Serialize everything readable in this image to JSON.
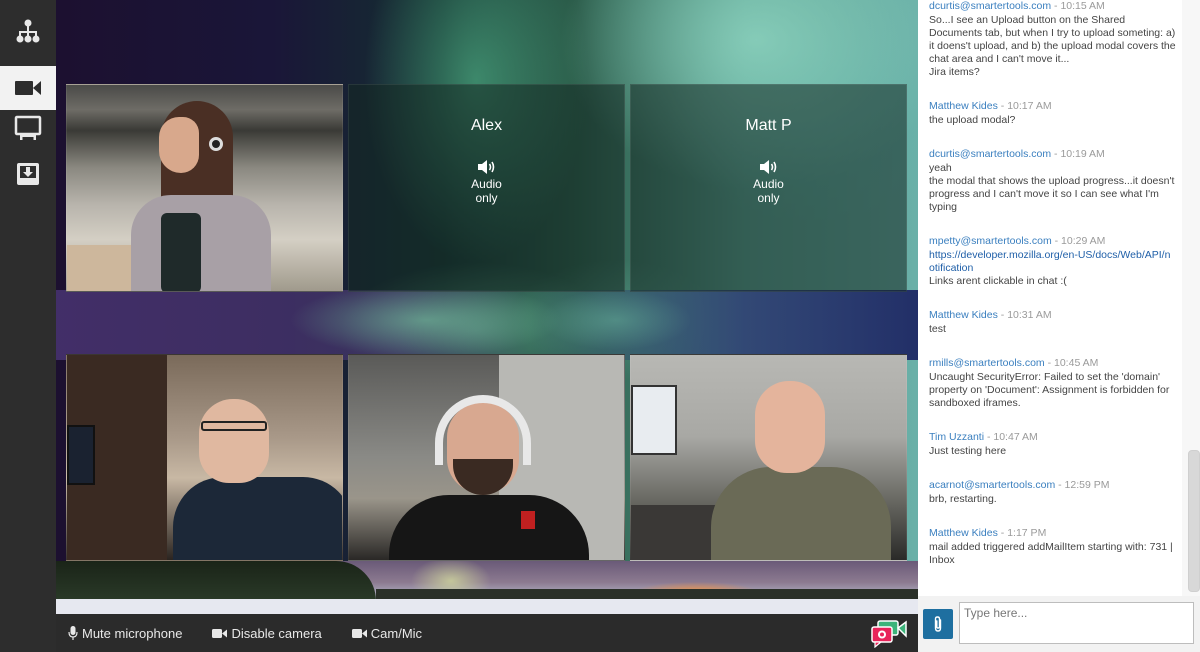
{
  "nav": {
    "items": [
      {
        "name": "org-chart-icon",
        "label": "Participants",
        "active": false
      },
      {
        "name": "video-camera-icon",
        "label": "Video",
        "active": true
      },
      {
        "name": "monitor-icon",
        "label": "Screen share",
        "active": false
      },
      {
        "name": "download-tray-icon",
        "label": "Shared documents",
        "active": false
      }
    ]
  },
  "participants": [
    {
      "id": "p1",
      "type": "video",
      "name": ""
    },
    {
      "id": "p2",
      "type": "audio",
      "name": "Alex",
      "status": "Audio only"
    },
    {
      "id": "p3",
      "type": "audio",
      "name": "Matt P",
      "status": "Audio only"
    },
    {
      "id": "p4",
      "type": "video",
      "name": ""
    },
    {
      "id": "p5",
      "type": "video",
      "name": ""
    },
    {
      "id": "p6",
      "type": "video",
      "name": ""
    }
  ],
  "audio_tiles": {
    "alex": {
      "name": "Alex",
      "status_line1": "Audio",
      "status_line2": "only"
    },
    "mattp": {
      "name": "Matt P",
      "status_line1": "Audio",
      "status_line2": "only"
    }
  },
  "toolbar": {
    "mute_label": "Mute microphone",
    "camera_label": "Disable camera",
    "cammic_label": "Cam/Mic"
  },
  "chat": {
    "messages": [
      {
        "author": "dcurtis@smartertools.com",
        "time": " - 10:15 AM",
        "lines": [
          "So...I see an Upload button on the Shared Documents tab, but when I try to upload someting: a) it doens't upload, and b) the upload modal covers the chat area and I can't move it...",
          "Jira items?"
        ]
      },
      {
        "author": "Matthew Kides",
        "time": " - 10:17 AM",
        "lines": [
          "the upload modal?"
        ]
      },
      {
        "author": "dcurtis@smartertools.com",
        "time": " - 10:19 AM",
        "lines": [
          "yeah",
          "the modal that shows the upload progress...it doesn't progress and I can't move it so I can see what I'm typing"
        ]
      },
      {
        "author": "mpetty@smartertools.com",
        "time": " - 10:29 AM",
        "link": "https://developer.mozilla.org/en-US/docs/Web/API/notification",
        "lines": [
          "Links arent clickable in chat :("
        ]
      },
      {
        "author": "Matthew Kides",
        "time": " - 10:31 AM",
        "lines": [
          "test"
        ]
      },
      {
        "author": "rmills@smartertools.com",
        "time": " - 10:45 AM",
        "lines": [
          "Uncaught SecurityError: Failed to set the 'domain' property on 'Document': Assignment is forbidden for sandboxed iframes."
        ]
      },
      {
        "author": "Tim Uzzanti",
        "time": " - 10:47 AM",
        "lines": [
          "Just testing here"
        ]
      },
      {
        "author": "acarnot@smartertools.com",
        "time": " - 12:59 PM",
        "lines": [
          "brb, restarting."
        ]
      },
      {
        "author": "Matthew Kides",
        "time": " - 1:17 PM",
        "lines": [
          "mail added triggered addMailItem starting with: 731 | Inbox"
        ]
      }
    ],
    "input_placeholder": "Type here...",
    "input_value": ""
  },
  "colors": {
    "accent": "#1e6fa0",
    "author": "#3a7fbf",
    "link": "#1f5fa8",
    "brand_red": "#e8245a",
    "brand_green": "#3db37a"
  }
}
